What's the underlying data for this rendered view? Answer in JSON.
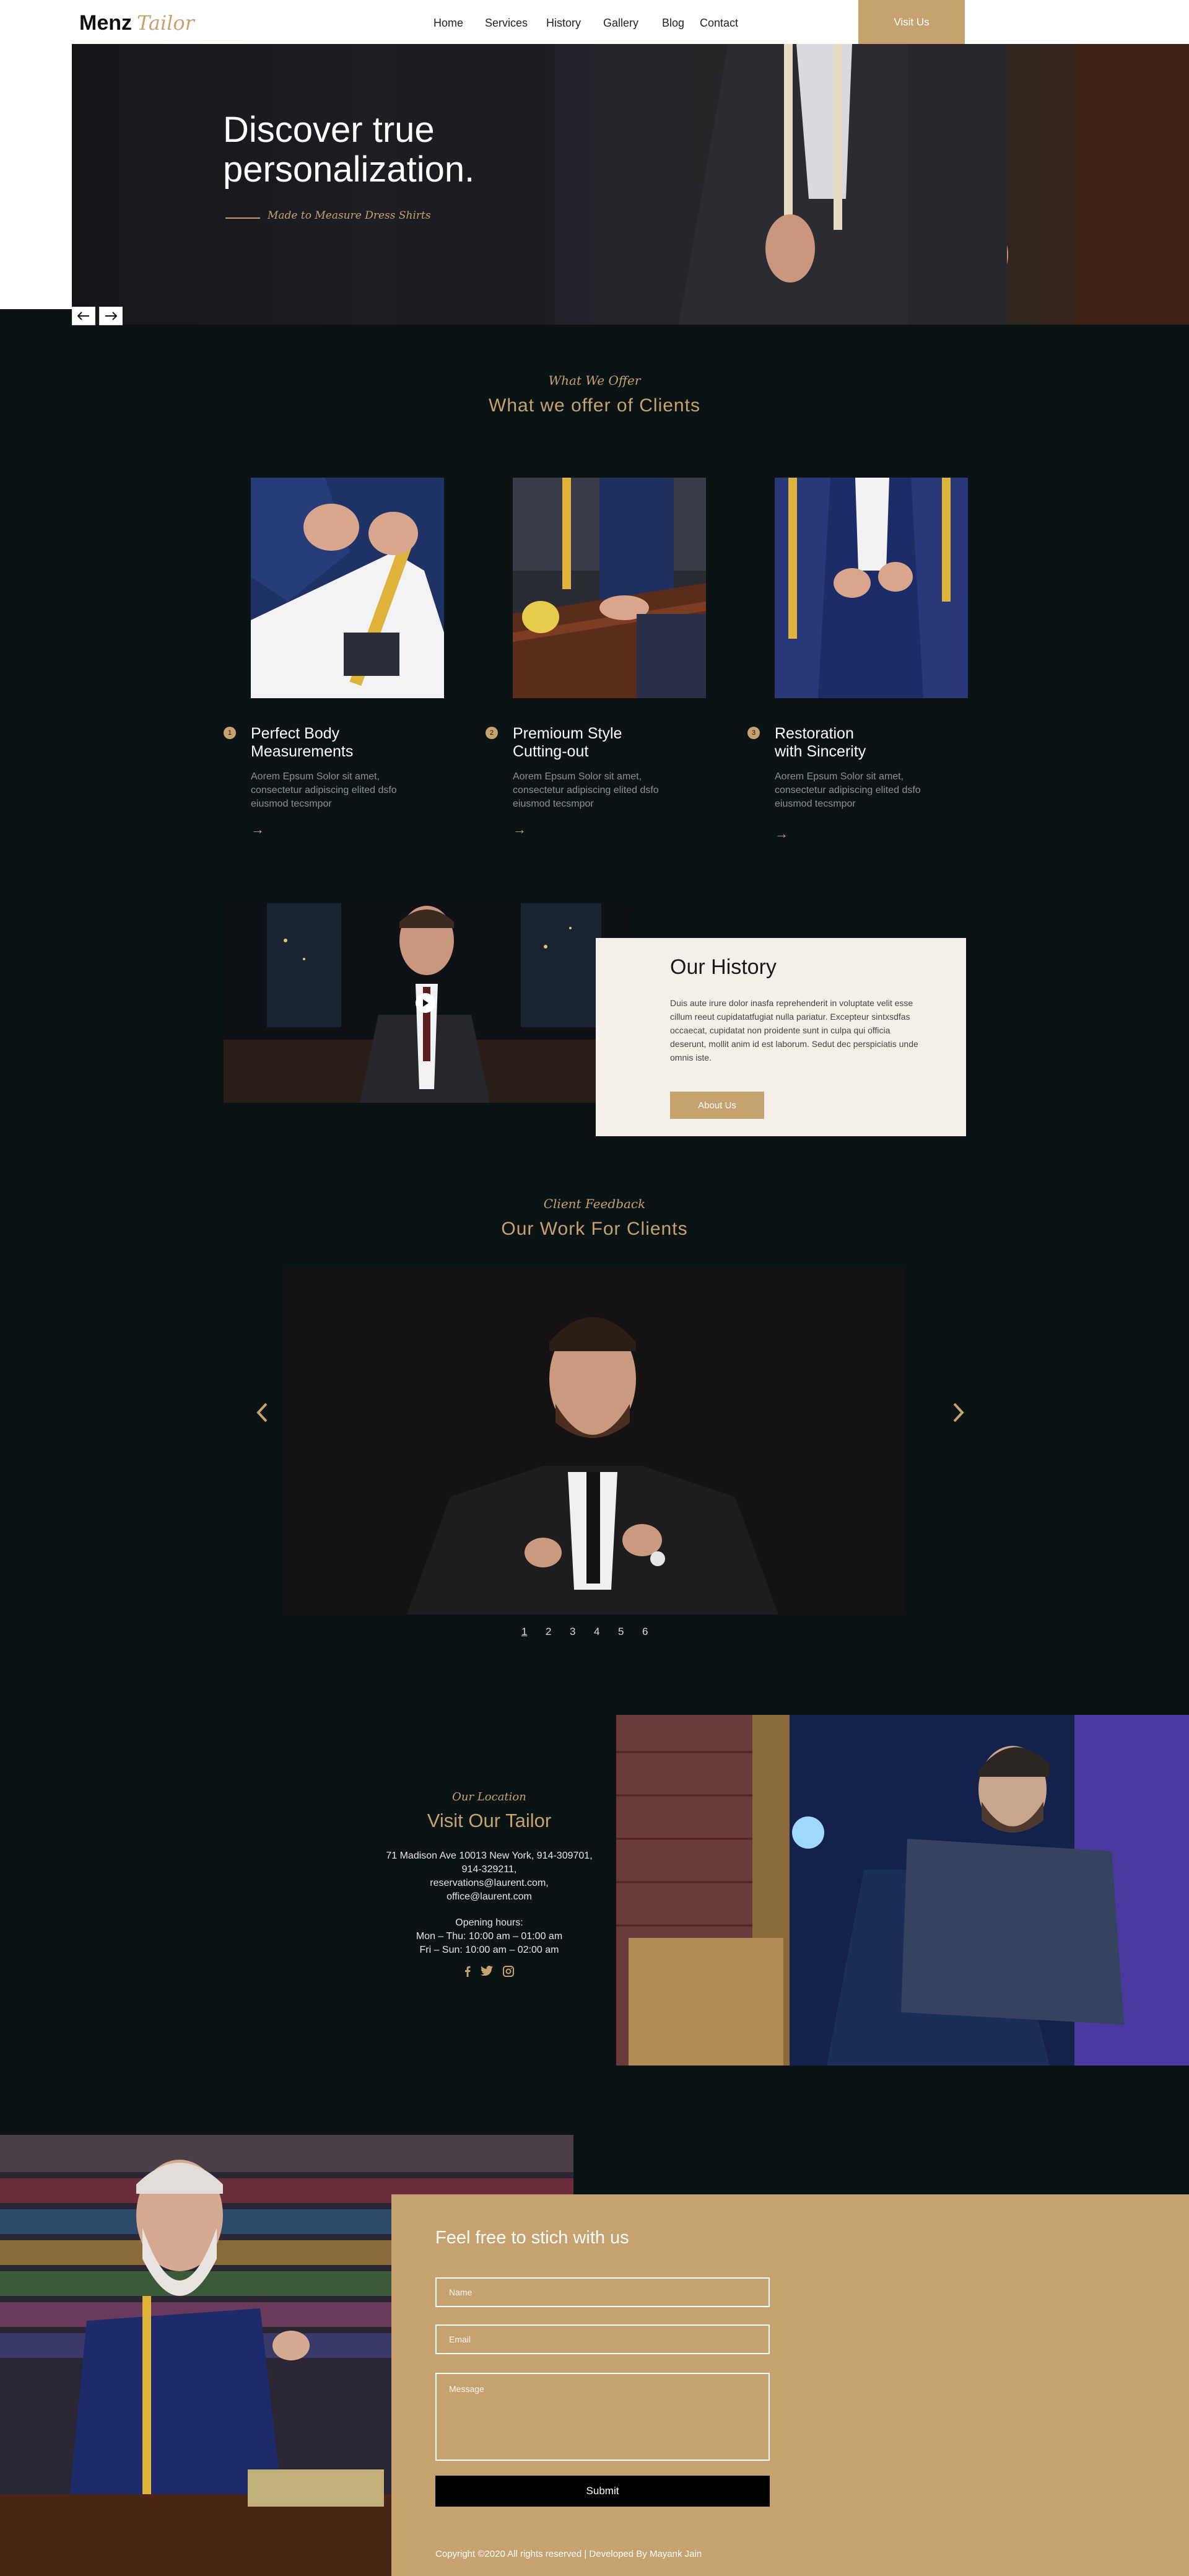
{
  "header": {
    "brand_main": "Menz",
    "brand_script": "Tailor",
    "nav": [
      "Home",
      "Services",
      "History",
      "Gallery",
      "Blog",
      "Contact"
    ],
    "visit_button": "Visit Us"
  },
  "hero": {
    "title_line1": "Discover true",
    "title_line2": "personalization.",
    "subtitle": "Made to Measure Dress Shirts",
    "prev_icon": "arrow-left-icon",
    "next_icon": "arrow-right-icon"
  },
  "offer": {
    "script": "What We Offer",
    "title": "What we offer of Clients",
    "cards": [
      {
        "num": "1",
        "title_line1": "Perfect Body",
        "title_line2": "Measurements",
        "text_line1": "Aorem Epsum Solor sit amet,",
        "text_line2": "consectetur adipiscing elited dsfo",
        "text_line3": "eiusmod tecsmpor"
      },
      {
        "num": "2",
        "title_line1": "Premioum Style",
        "title_line2": "Cutting-out",
        "text_line1": "Aorem Epsum Solor sit amet,",
        "text_line2": "consectetur adipiscing elited dsfo",
        "text_line3": "eiusmod tecsmpor"
      },
      {
        "num": "3",
        "title_line1": "Restoration",
        "title_line2": "with Sincerity",
        "text_line1": "Aorem Epsum Solor sit amet,",
        "text_line2": "consectetur adipiscing elited dsfo",
        "text_line3": "eiusmod tecsmpor"
      }
    ]
  },
  "history": {
    "title": "Our History",
    "text": "Duis aute irure dolor inasfa reprehenderit in voluptate velit esse cillum reeut cupidatatfugiat nulla pariatur. Excepteur sintxsdfas occaecat, cupidatat non proidente sunt in culpa qui officia deserunt, mollit anim id est laborum. Sedut dec perspiciatis unde omnis iste.",
    "button": "About Us"
  },
  "gallery": {
    "script": "Client Feedback",
    "title": "Our Work For Clients",
    "pages": [
      "1",
      "2",
      "3",
      "4",
      "5",
      "6"
    ],
    "active_page": "1"
  },
  "location": {
    "script": "Our Location",
    "title": "Visit Our Tailor",
    "address_line1": "71 Madison Ave 10013 New York, 914-309701,",
    "address_line2": "914-329211,",
    "email1": "reservations@laurent.com,",
    "email2": "office@laurent.com",
    "hours_label": "Opening hours:",
    "hours1": "Mon – Thu: 10:00 am – 01:00 am",
    "hours2": "Fri – Sun: 10:00 am – 02:00 am",
    "social": [
      "facebook-icon",
      "twitter-icon",
      "instagram-icon"
    ]
  },
  "contact": {
    "title": "Feel free to stich with us",
    "name_placeholder": "Name",
    "email_placeholder": "Email",
    "message_placeholder": "Message",
    "submit": "Submit",
    "copyright": "Copyright ©2020 All rights reserved | Developed By Mayank Jain"
  },
  "colors": {
    "background": "#0b1415",
    "accent": "#c6a26f",
    "history_box": "#f4efe8"
  }
}
